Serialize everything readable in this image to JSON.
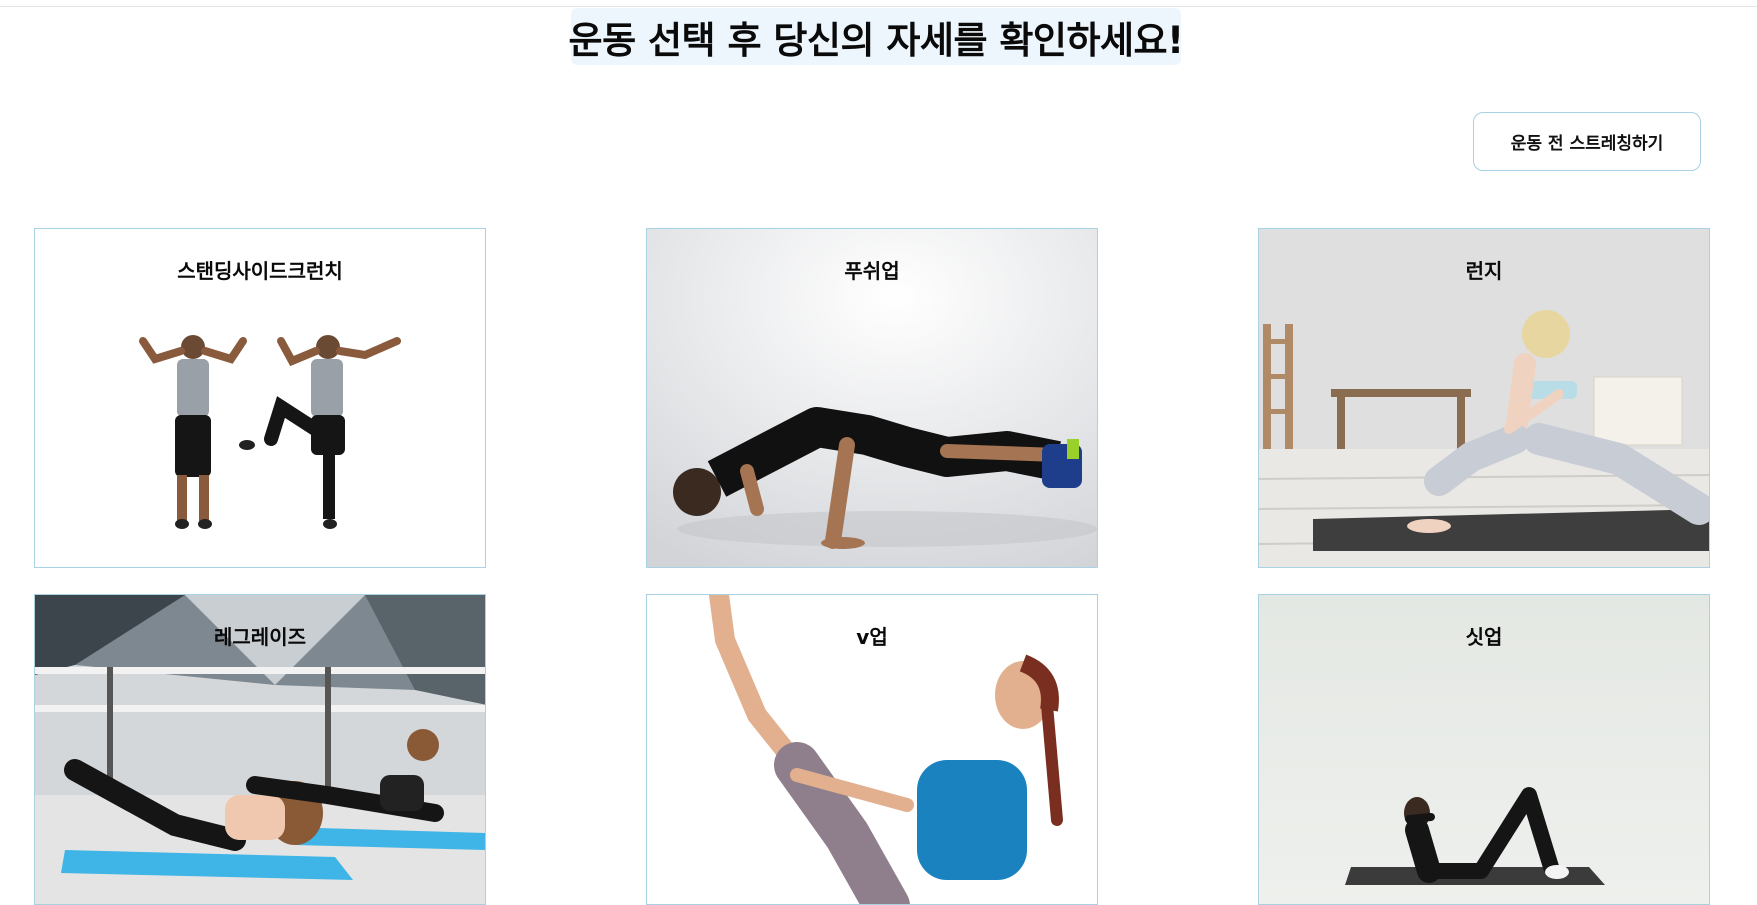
{
  "header": {
    "title": "운동 선택 후 당신의 자세를 확인하세요!",
    "stretch_button": "운동 전 스트레칭하기"
  },
  "exercises": [
    {
      "label": "스탠딩사이드크런치",
      "image": "standing-side-crunch-photo"
    },
    {
      "label": "푸쉬업",
      "image": "push-up-photo"
    },
    {
      "label": "런지",
      "image": "lunge-photo"
    },
    {
      "label": "레그레이즈",
      "image": "leg-raise-photo"
    },
    {
      "label": "v업",
      "image": "v-up-photo"
    },
    {
      "label": "싯업",
      "image": "sit-up-photo"
    }
  ],
  "colors": {
    "title_bg": "#eef6fd",
    "card_border": "#a9d2e4",
    "button_border": "#a8d0e6"
  }
}
